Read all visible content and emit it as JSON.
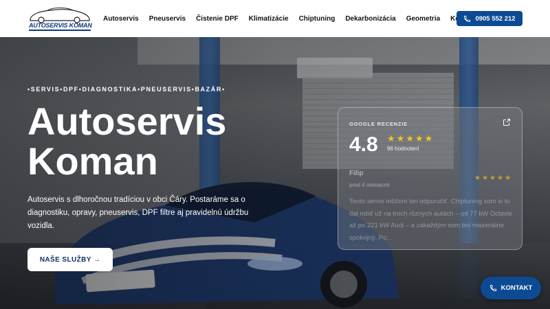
{
  "header": {
    "logo_text": "AUTOSERVIS KOMAN",
    "nav": [
      {
        "label": "Autoservis"
      },
      {
        "label": "Pneuservis"
      },
      {
        "label": "Čistenie DPF"
      },
      {
        "label": "Klimatizácie"
      },
      {
        "label": "Chiptuning"
      },
      {
        "label": "Dekarbonizácia"
      },
      {
        "label": "Geometria"
      },
      {
        "label": "Kontakt"
      }
    ],
    "phone": "0905 552 212"
  },
  "hero": {
    "tagline": "•SERVIS•DPF•DIAGNOSTIKA•PNEUSERVIS•BAZÁR•",
    "title_line1": "Autoservis",
    "title_line2": "Koman",
    "description": "Autoservis s dlhoročnou tradíciou v obci Čáry. Postaráme sa o diagnostiku, opravy, pneuservis, DPF filtre aj pravidelnú údržbu vozidla.",
    "cta_label": "NAŠE SLUŽBY →"
  },
  "review_card": {
    "label": "GOOGLE RECENZIE",
    "rating": "4.8",
    "rating_count": "96 hodnotení",
    "rating_stars": 5,
    "reviewer": "Filip",
    "time": "pred 4 mesiacmi",
    "text": "Tento servis môžem len odporučiť. Chiptuning som si tu dal robiť už na troch rôznych autách – od 77 kW Octavie až po 221 kW Audi – a zakaždým som bol maximálne spokojný. Po…"
  },
  "floating": {
    "contact_label": "KONTAKT"
  },
  "colors": {
    "brand_blue": "#0d4a94",
    "star": "#f6c324"
  }
}
